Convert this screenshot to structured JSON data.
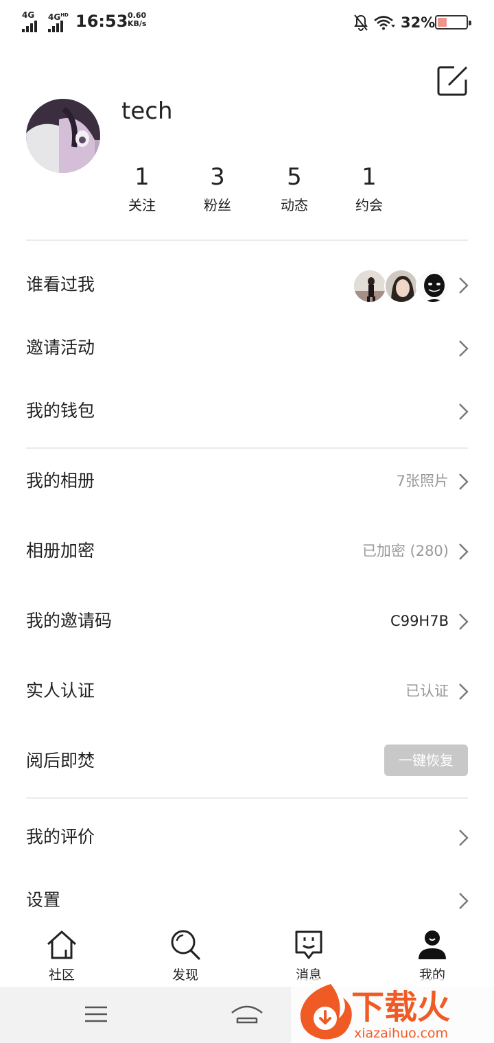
{
  "status_bar": {
    "sim1": "4G",
    "sim2": "4G",
    "sim2_sup": "HD",
    "time": "16:53",
    "speed_value": "0.60",
    "speed_unit": "KB/s",
    "battery_pct": "32%",
    "battery_level": 0.32,
    "icons": [
      "bell-off-icon",
      "wifi-icon",
      "battery-icon"
    ]
  },
  "profile": {
    "username": "tech",
    "stats": [
      {
        "num": "1",
        "label": "关注"
      },
      {
        "num": "3",
        "label": "粉丝"
      },
      {
        "num": "5",
        "label": "动态"
      },
      {
        "num": "1",
        "label": "约会"
      }
    ]
  },
  "menu": {
    "visitors": {
      "label": "谁看过我"
    },
    "invite_activity": {
      "label": "邀请活动"
    },
    "wallet": {
      "label": "我的钱包"
    },
    "album": {
      "label": "我的相册",
      "value": "7张照片"
    },
    "album_lock": {
      "label": "相册加密",
      "value": "已加密 (280)"
    },
    "invite_code": {
      "label": "我的邀请码",
      "value": "C99H7B"
    },
    "verify": {
      "label": "实人认证",
      "value": "已认证"
    },
    "burn": {
      "label": "阅后即焚",
      "button": "一键恢复"
    },
    "reviews": {
      "label": "我的评价"
    },
    "settings": {
      "label": "设置"
    }
  },
  "tabbar": {
    "tabs": [
      {
        "label": "社区",
        "icon": "home-icon"
      },
      {
        "label": "发现",
        "icon": "search-icon"
      },
      {
        "label": "消息",
        "icon": "message-icon"
      },
      {
        "label": "我的",
        "icon": "user-icon"
      }
    ],
    "active_index": 3
  },
  "watermark": {
    "brand": "下载火",
    "url": "xiazaihuo.com"
  },
  "colors": {
    "accent_orange": "#f05a24",
    "muted_text": "#999999",
    "divider": "#ebebeb",
    "button_disabled": "#c8c8c8",
    "battery_low": "#f0938d"
  }
}
